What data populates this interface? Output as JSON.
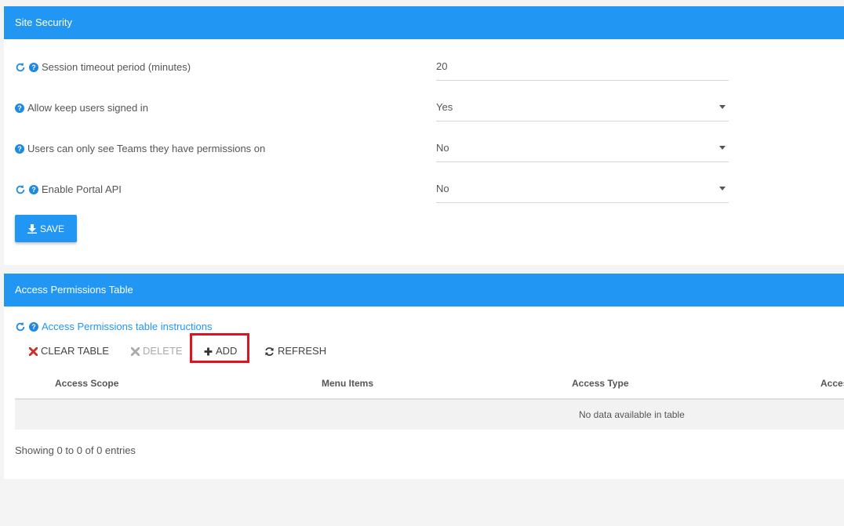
{
  "site_security": {
    "title": "Site Security",
    "rows": [
      {
        "label": "Session timeout period (minutes)",
        "value": "20",
        "has_refresh": true,
        "dropdown": false
      },
      {
        "label": "Allow keep users signed in",
        "value": "Yes",
        "has_refresh": false,
        "dropdown": true
      },
      {
        "label": "Users can only see Teams they have permissions on",
        "value": "No",
        "has_refresh": false,
        "dropdown": true
      },
      {
        "label": "Enable Portal API",
        "value": "No",
        "has_refresh": true,
        "dropdown": true
      }
    ],
    "save_label": "SAVE"
  },
  "access_permissions": {
    "title": "Access Permissions Table",
    "instructions_link": "Access Permissions table instructions",
    "toolbar": {
      "clear_label": "CLEAR TABLE",
      "delete_label": "DELETE",
      "add_label": "ADD",
      "refresh_label": "REFRESH"
    },
    "columns": [
      "Access Scope",
      "Menu Items",
      "Access Type",
      "Acces"
    ],
    "empty_message": "No data available in table",
    "info": "Showing 0 to 0 of 0 entries"
  },
  "colors": {
    "header_blue": "#2196f3",
    "icon_blue": "#1e88e5",
    "highlight_red": "#e0141f",
    "clear_red": "#c9302c"
  },
  "icons": [
    "refresh-icon",
    "help-icon",
    "download-icon",
    "times-icon",
    "plus-icon",
    "sync-icon",
    "caret-down-icon"
  ]
}
